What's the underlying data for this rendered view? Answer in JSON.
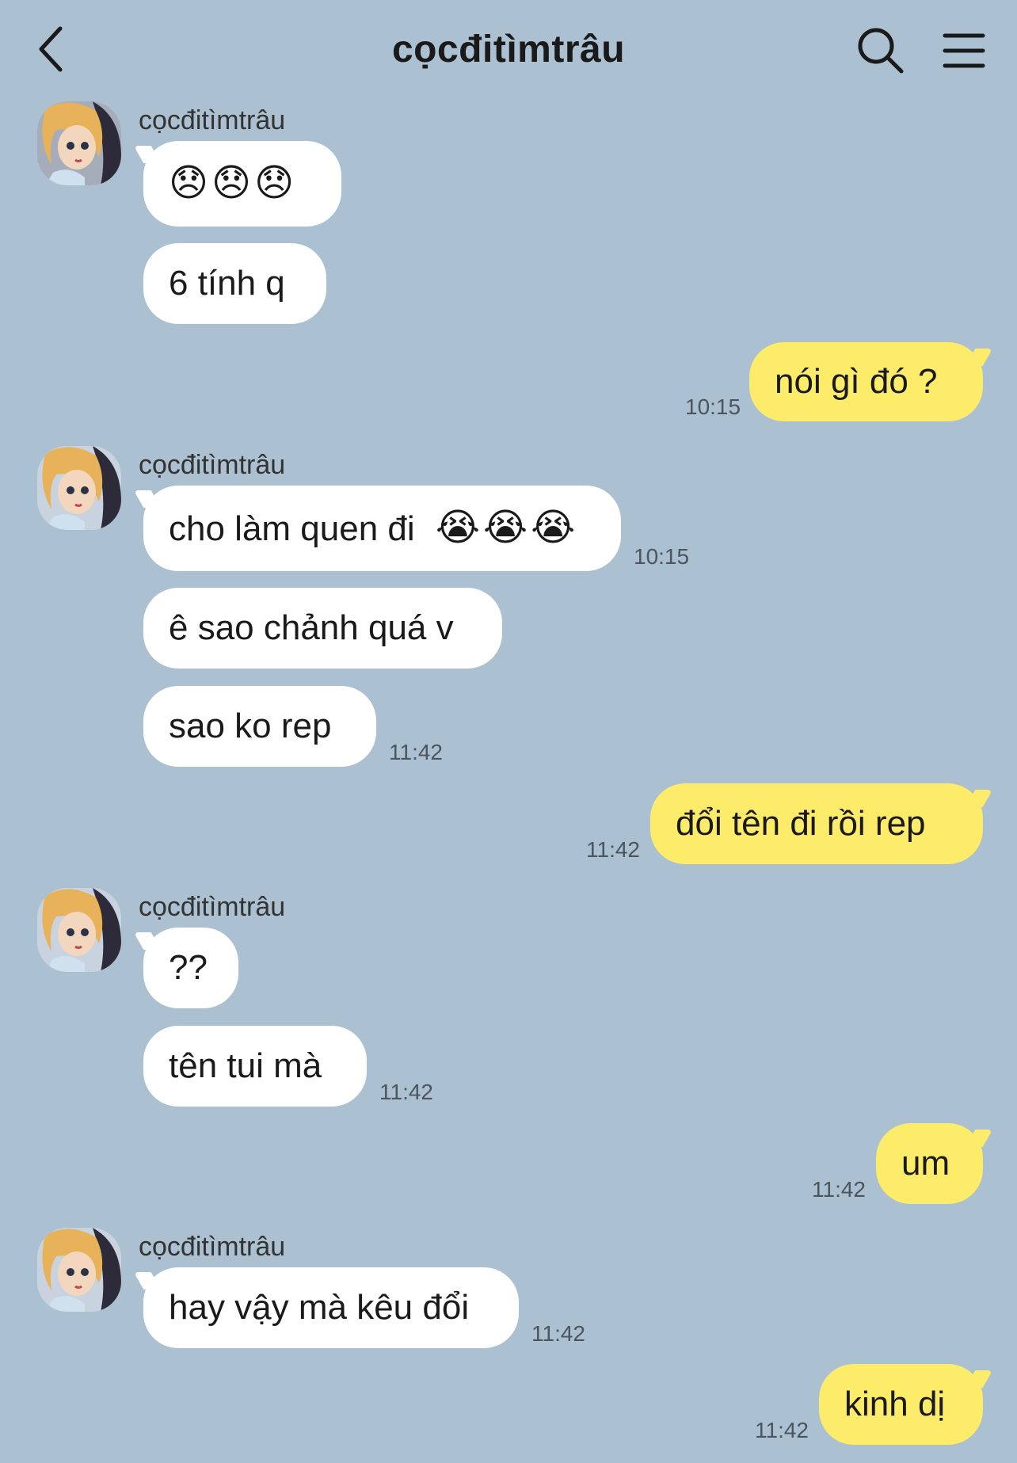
{
  "header": {
    "title": "cọcđitìmtrâu"
  },
  "icons": {
    "back": "chevron-left-icon",
    "search": "search-icon",
    "menu": "hamburger-menu-icon",
    "sad_emoji": "disappointed-face-emoji",
    "cry_emoji": "loudly-crying-face-emoji"
  },
  "colors": {
    "background": "#abc1d1",
    "my_bubble": "#fdeb6a",
    "their_bubble": "#ffffff"
  },
  "messages": {
    "g1_sender": "cọcđitìmtrâu",
    "m1_emojis": "😞😞😞",
    "m2": "6 tính q",
    "m3": "nói gì đó ?",
    "t3": "10:15",
    "g2_sender": "cọcđitìmtrâu",
    "m4": "cho làm quen đi",
    "t4": "10:15",
    "m5": "ê sao chảnh quá v",
    "m6": "sao ko rep",
    "t6": "11:42",
    "m7": "đổi tên đi rồi rep",
    "t7": "11:42",
    "g3_sender": "cọcđitìmtrâu",
    "m8": "??",
    "m9": "tên tui mà",
    "t9": "11:42",
    "m10": "um",
    "t10": "11:42",
    "g4_sender": "cọcđitìmtrâu",
    "m11": "hay vậy mà kêu đổi",
    "t11": "11:42",
    "m12": "kinh dị",
    "t12": "11:42"
  }
}
